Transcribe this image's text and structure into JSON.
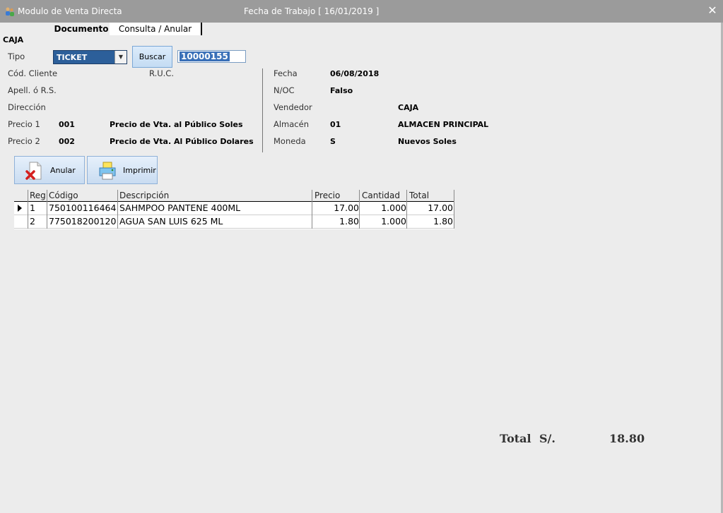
{
  "window": {
    "title": "Modulo de Venta Directa",
    "work_date": "Fecha de Trabajo [ 16/01/2019 ]",
    "close_glyph": "✕",
    "icon": "app-people-icon"
  },
  "tabs": [
    {
      "label": "Documento",
      "active": true
    },
    {
      "label": "Consulta / Anular",
      "active": false
    }
  ],
  "section_title": "CAJA",
  "form": {
    "tipo_label": "Tipo",
    "tipo_value": "TICKET",
    "buscar_label": "Buscar",
    "doc_number": "10000155",
    "cod_cliente_label": "Cód. Cliente",
    "ruc_label": "R.U.C.",
    "apell_label": "Apell. ó R.S.",
    "direccion_label": "Dirección",
    "precio1_label": "Precio 1",
    "precio1_code": "001",
    "precio1_desc": "Precio de Vta. al Público Soles",
    "precio2_label": "Precio 2",
    "precio2_code": "002",
    "precio2_desc": "Precio de Vta. Al Público Dolares",
    "fecha_label": "Fecha",
    "fecha_value": "06/08/2018",
    "noc_label": "N/OC",
    "noc_value": "Falso",
    "vendedor_label": "Vendedor",
    "vendedor_value": "CAJA",
    "almacen_label": "Almacén",
    "almacen_code": "01",
    "almacen_name": "ALMACEN PRINCIPAL",
    "moneda_label": "Moneda",
    "moneda_code": "S",
    "moneda_name": "Nuevos Soles"
  },
  "actions": {
    "anular_label": "Anular",
    "imprimir_label": "Imprimir"
  },
  "grid": {
    "columns": [
      "Reg",
      "Código",
      "Descripción",
      "Precio",
      "Cantidad",
      "Total"
    ],
    "rows": [
      {
        "reg": "1",
        "codigo": "750100116464",
        "descripcion": "SAHMPOO PANTENE 400ML",
        "precio": "17.00",
        "cantidad": "1.000",
        "total": "17.00"
      },
      {
        "reg": "2",
        "codigo": "775018200120",
        "descripcion": "AGUA SAN LUIS 625 ML",
        "precio": "1.80",
        "cantidad": "1.000",
        "total": "1.80"
      }
    ]
  },
  "summary": {
    "total_label": "Total",
    "currency": "S/.",
    "total_value": "18.80"
  }
}
